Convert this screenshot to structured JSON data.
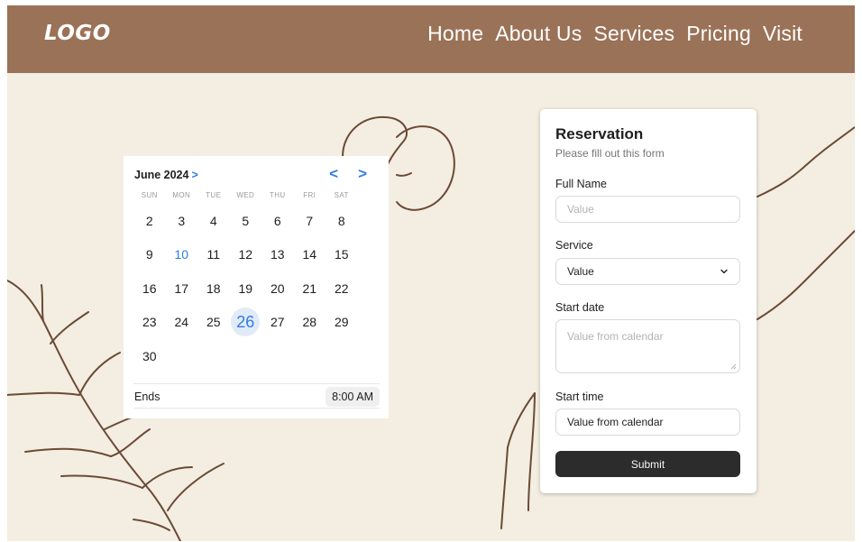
{
  "navbar": {
    "logo": "LOGO",
    "links": [
      "Home",
      "About Us",
      "Services",
      "Pricing",
      "Visit"
    ],
    "background": "#9a7257"
  },
  "page_background": "#f3eee1",
  "calendar": {
    "month_label": "June 2024",
    "month_chevron": ">",
    "prev_icon": "<",
    "next_icon": ">",
    "weekdays": [
      "SUN",
      "MON",
      "TUE",
      "WED",
      "THU",
      "FRI",
      "SAT"
    ],
    "days": [
      "2",
      "3",
      "4",
      "5",
      "6",
      "7",
      "8",
      "9",
      "10",
      "11",
      "12",
      "13",
      "14",
      "15",
      "16",
      "17",
      "18",
      "19",
      "20",
      "21",
      "22",
      "23",
      "24",
      "25",
      "26",
      "27",
      "28",
      "29",
      "30"
    ],
    "today": "10",
    "selected": "26",
    "ends_label": "Ends",
    "ends_time": "8:00 AM",
    "accent": "#2f7ce6"
  },
  "form": {
    "title": "Reservation",
    "subtitle": "Please fill out this form",
    "full_name_label": "Full Name",
    "full_name_placeholder": "Value",
    "service_label": "Service",
    "service_value": "Value",
    "service_icon": "chevron-down-icon",
    "start_date_label": "Start date",
    "start_date_placeholder": "Value from calendar",
    "start_time_label": "Start time",
    "start_time_value": "Value from calendar",
    "submit_label": "Submit",
    "submit_color": "#2c2c2c"
  }
}
